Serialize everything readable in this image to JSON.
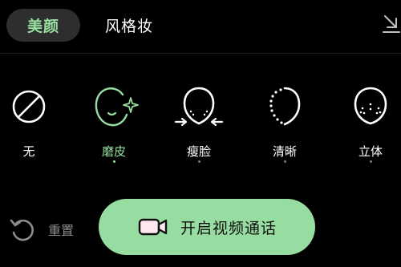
{
  "tabs": {
    "beauty": "美颜",
    "style": "风格妆"
  },
  "icons": {
    "collapse": "collapse-down-icon",
    "reset": "reset-icon",
    "video": "video-camera-icon"
  },
  "options": [
    {
      "label": "无",
      "icon": "none-icon",
      "selected": false
    },
    {
      "label": "磨皮",
      "icon": "smooth-skin-icon",
      "selected": true
    },
    {
      "label": "瘦脸",
      "icon": "slim-face-icon",
      "selected": false
    },
    {
      "label": "清晰",
      "icon": "clarity-icon",
      "selected": false
    },
    {
      "label": "立体",
      "icon": "contour-icon",
      "selected": false
    }
  ],
  "bottom": {
    "reset_label": "重置",
    "start_video_label": "开启视频通话"
  },
  "colors": {
    "accent": "#98dea0",
    "button_bg": "#97dca0",
    "background": "#000000",
    "muted": "#8c8c8c"
  }
}
